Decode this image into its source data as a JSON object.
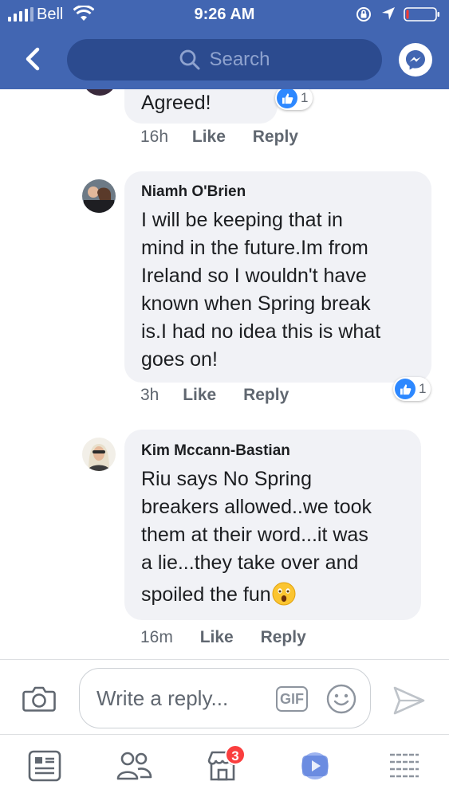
{
  "status_bar": {
    "carrier": "Bell",
    "time": "9:26 AM"
  },
  "nav": {
    "search_placeholder": "Search",
    "icons": [
      "back-arrow",
      "search",
      "messenger"
    ]
  },
  "comments": [
    {
      "author": "",
      "text_lines": [
        "Agreed!"
      ],
      "reaction_count": "1",
      "time": "16h",
      "like_label": "Like",
      "reply_label": "Reply"
    },
    {
      "author": "Niamh O'Brien",
      "text_lines": [
        "I will be keeping that in",
        "mind in the future.Im from",
        "Ireland so I wouldn't have",
        "known when Spring break",
        "is.I had no idea this is what",
        "goes on!"
      ],
      "reaction_count": "1",
      "time": "3h",
      "like_label": "Like",
      "reply_label": "Reply"
    },
    {
      "author": "Kim Mccann-Bastian",
      "text_lines": [
        "Riu says No Spring",
        "breakers allowed..we took",
        "them at their word...it was",
        "a lie...they take over and",
        "spoiled the fun"
      ],
      "trailing_emoji": "astonished-face",
      "time": "16m",
      "like_label": "Like",
      "reply_label": "Reply"
    }
  ],
  "composer": {
    "placeholder": "Write a reply...",
    "gif_label": "GIF"
  },
  "tabbar": {
    "marketplace_badge": "3",
    "tabs": [
      "news-feed",
      "groups",
      "marketplace",
      "watch",
      "menu"
    ]
  },
  "colors": {
    "header": "#4266b2",
    "search_pill": "#2c4b8f",
    "bubble": "#f1f2f6",
    "like_blue": "#2d88ff",
    "badge_red": "#fa3e3e"
  }
}
